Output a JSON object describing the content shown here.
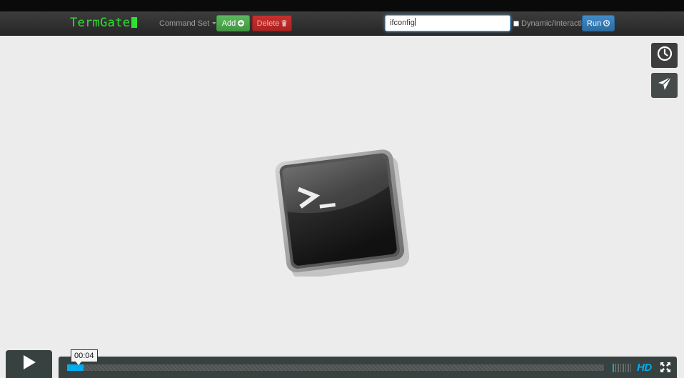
{
  "navbar": {
    "brand": "TermGate",
    "command_set_label": "Command Set",
    "add_label": "Add",
    "delete_label": "Delete",
    "command_value": "ifconfig",
    "dynamic_label": "Dynamic/Interactive",
    "run_label": "Run"
  },
  "video": {
    "timecode": "00:04",
    "progress_fraction": 0.03,
    "volume_level": 0.2,
    "hd_label": "HD"
  },
  "icons": {
    "later": "clock-icon",
    "share": "paper-plane-icon",
    "play": "play-icon",
    "fullscreen": "fullscreen-icon",
    "terminal": "terminal-app-icon"
  },
  "colors": {
    "brand_green": "#2fe02f",
    "accent_blue": "#00adef",
    "add_green": "#5cb85c",
    "delete_red": "#c9302c",
    "run_blue": "#428bca"
  }
}
